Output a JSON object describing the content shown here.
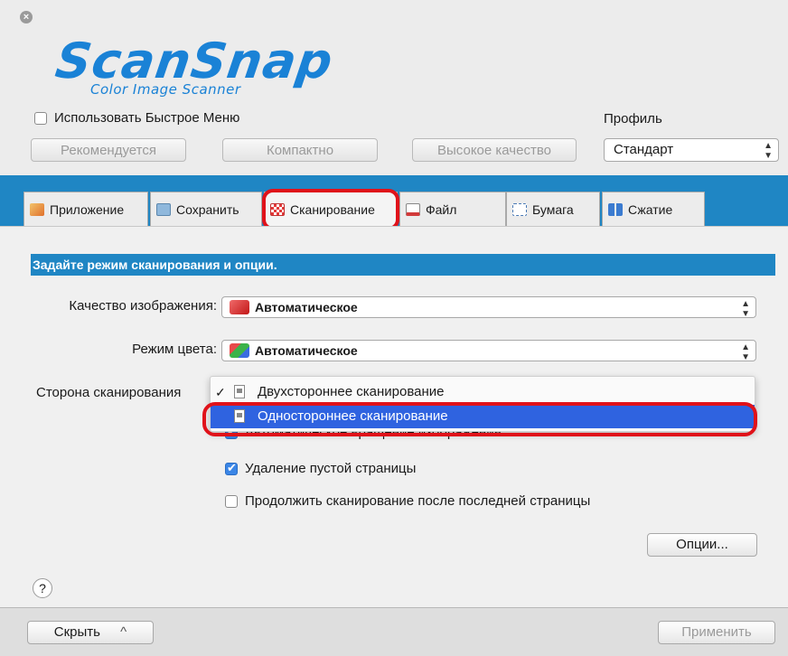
{
  "window": {
    "close_icon": "close-icon",
    "logo": {
      "main": "ScanSnap",
      "sub": "Color Image Scanner"
    }
  },
  "quick_menu": {
    "label": "Использовать Быстрое Меню",
    "checked": false
  },
  "profile": {
    "label": "Профиль",
    "value": "Стандарт"
  },
  "modes": [
    {
      "label": "Рекомендуется"
    },
    {
      "label": "Компактно"
    },
    {
      "label": "Высокое качество"
    }
  ],
  "tabs": [
    {
      "label": "Приложение",
      "icon": "application-icon"
    },
    {
      "label": "Сохранить",
      "icon": "folder-icon"
    },
    {
      "label": "Сканирование",
      "icon": "scan-icon",
      "active": true
    },
    {
      "label": "Файл",
      "icon": "file-icon"
    },
    {
      "label": "Бумага",
      "icon": "paper-icon"
    },
    {
      "label": "Сжатие",
      "icon": "compression-icon"
    }
  ],
  "section": {
    "title": "Задайте режим сканирования и опции."
  },
  "fields": {
    "image_quality": {
      "label": "Качество изображения:",
      "value": "Автоматическое"
    },
    "color_mode": {
      "label": "Режим цвета:",
      "value": "Автоматическое"
    },
    "scan_side": {
      "label": "Сторона сканирования"
    }
  },
  "scan_side_menu": {
    "check": "✓",
    "items": [
      {
        "label": "Двухстороннее сканирование",
        "checked": true
      },
      {
        "label": "Одностороннее сканирование",
        "selected": true
      }
    ]
  },
  "options": {
    "auto_rotate": {
      "label": "Автоматическое вращение изображения",
      "checked": true
    },
    "blank_page_removal": {
      "label": "Удаление пустой страницы",
      "checked": true
    },
    "continue_scan": {
      "label": "Продолжить сканирование после последней страницы",
      "checked": false
    }
  },
  "buttons": {
    "options": "Опции...",
    "help": "?",
    "hide": "Скрыть",
    "hide_chevron": "^",
    "apply": "Применить"
  },
  "colors": {
    "accent_blue": "#1f86c4",
    "highlight_red": "#e0121a",
    "menu_selection": "#2f63e0",
    "logo_blue": "#1a82d6"
  }
}
